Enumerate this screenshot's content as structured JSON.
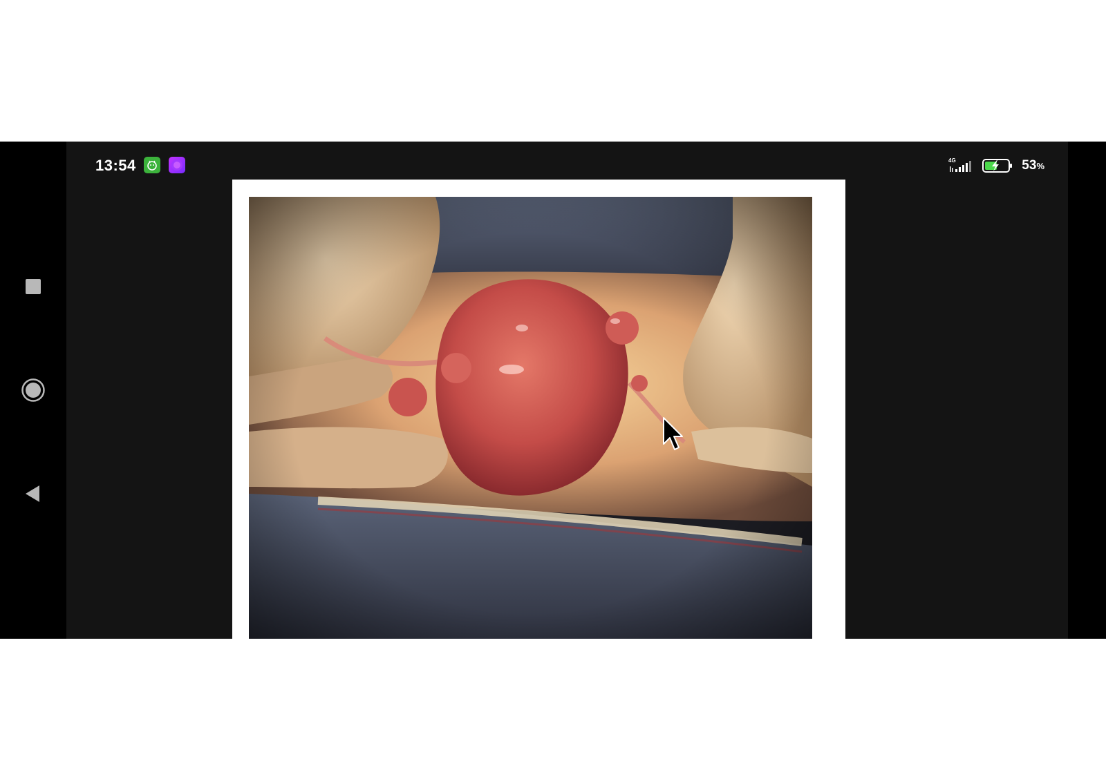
{
  "status_bar": {
    "time": "13:54",
    "notification_icons": [
      "android-robot-app-icon",
      "purple-app-icon"
    ],
    "network_label": "4G",
    "battery_percent": 53,
    "battery_text": "53",
    "battery_unit": "%"
  },
  "navigation_bar": {
    "buttons": [
      "recents-button",
      "home-button",
      "back-button"
    ]
  },
  "viewer": {
    "image_subject": "surgical-photo",
    "colors": {
      "tissue": "#c9544f",
      "glove": "#e8c9a0",
      "drape": "#4b5468"
    }
  }
}
